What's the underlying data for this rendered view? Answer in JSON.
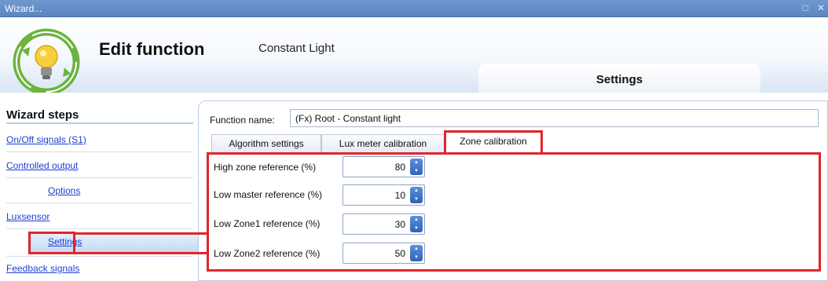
{
  "window": {
    "title": "Wizard...",
    "controls": "□ ✕"
  },
  "header": {
    "title": "Edit function",
    "subtitle": "Constant Light",
    "settings_tab": "Settings"
  },
  "sidebar": {
    "heading": "Wizard steps",
    "items": [
      {
        "label": "On/Off signals (S1)"
      },
      {
        "label": "Controlled output"
      },
      {
        "label": "Options"
      },
      {
        "label": "Luxsensor"
      },
      {
        "label": "Settings"
      },
      {
        "label": "Feedback signals"
      }
    ]
  },
  "function": {
    "label": "Function name:",
    "value": "(Fx) Root - Constant light"
  },
  "tabs": [
    {
      "label": "Algorithm settings"
    },
    {
      "label": "Lux meter calibration"
    },
    {
      "label": "Zone calibration"
    }
  ],
  "zone_calibration": {
    "rows": [
      {
        "label": "High zone reference (%)",
        "value": "80"
      },
      {
        "label": "Low master reference (%)",
        "value": "10"
      },
      {
        "label": "Low Zone1 reference (%)",
        "value": "30"
      },
      {
        "label": "Low Zone2 reference (%)",
        "value": "50"
      }
    ]
  },
  "colors": {
    "titlebar": "#5b86c0",
    "link": "#1d3fd4",
    "highlight": "#e0252b",
    "spin_button": "#2f64b8"
  }
}
